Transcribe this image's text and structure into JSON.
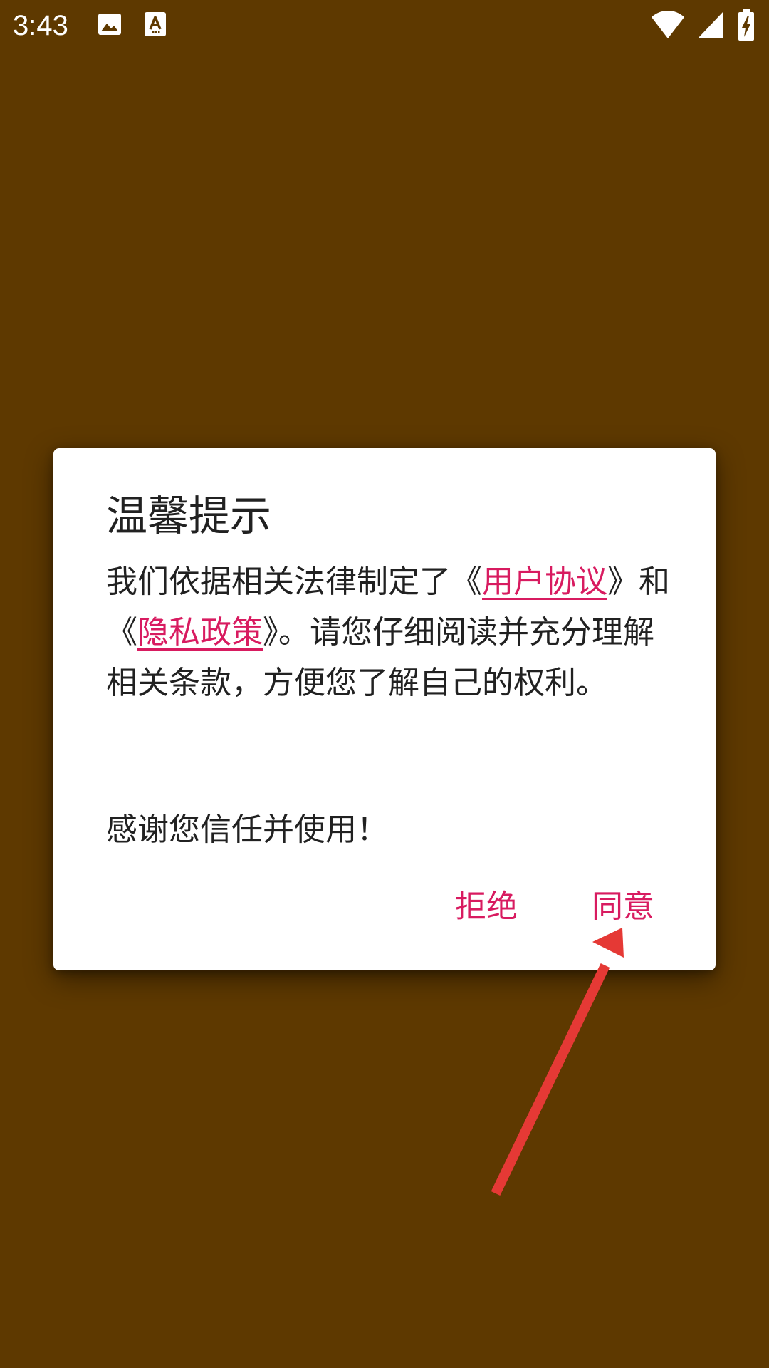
{
  "colors": {
    "background": "#5e3900",
    "dialog_bg": "#ffffff",
    "text": "#212121",
    "accent": "#d81b60",
    "arrow": "#e53935",
    "status_fg": "#ffffff"
  },
  "status_bar": {
    "time": "3:43",
    "left_icons": [
      "image-icon",
      "font-a-icon"
    ],
    "right_icons": [
      "wifi-icon",
      "cell-signal-icon",
      "battery-charging-icon"
    ]
  },
  "dialog": {
    "title": "温馨提示",
    "body": {
      "prefix": "我们依据相关法律制定了《",
      "link_user_agreement": "用户协议",
      "middle": "》和《",
      "link_privacy_policy": "隐私政策",
      "suffix": "》。请您仔细阅读并充分理解相关条款，方便您了解自己的权利。"
    },
    "thanks": "感谢您信任并使用！",
    "buttons": {
      "reject": "拒绝",
      "agree": "同意"
    }
  }
}
